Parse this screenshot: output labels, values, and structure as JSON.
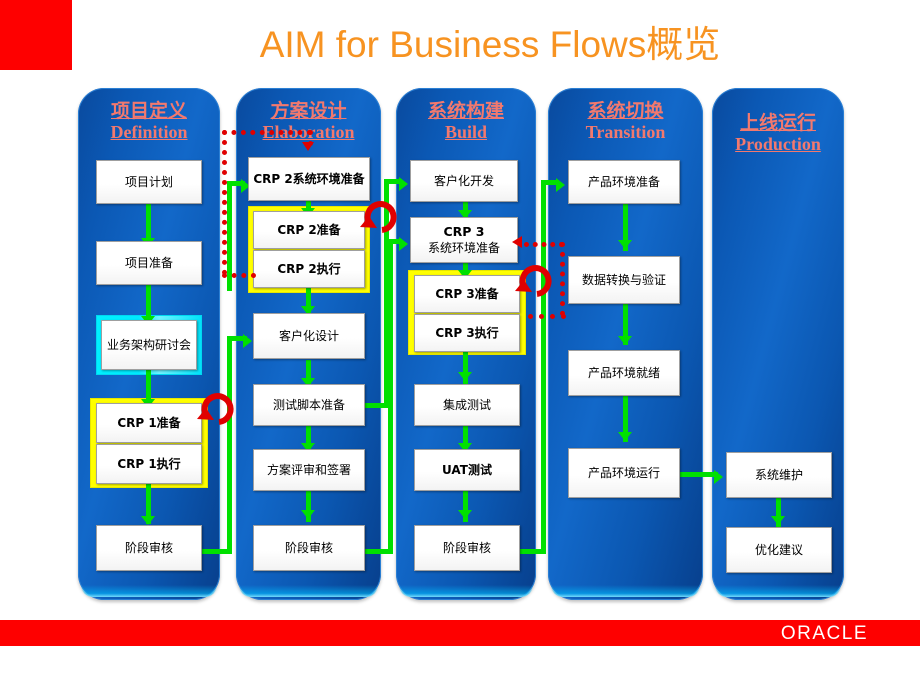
{
  "slide": {
    "title": "AIM for Business Flows概览",
    "title_color": "#f79321",
    "footer_brand": "ORACLE",
    "accent_red": "#fe0000",
    "column_bg_blue": "#0b58b4",
    "header_text_color": "#f2796e",
    "connector_green": "#00e000",
    "loop_red": "#e00000",
    "highlight_yellow": "#ffff00",
    "highlight_cyan": "#00e9ff"
  },
  "columns": [
    {
      "id": "definition",
      "title_cn": "项目定义",
      "title_en": "Definition",
      "boxes": [
        {
          "label": "项目计划",
          "bold": false
        },
        {
          "label": "项目准备",
          "bold": false
        },
        {
          "label": "业务架构研讨会",
          "bold": false,
          "highlight": "cyan"
        },
        {
          "label": "CRP 1准备",
          "bold": true,
          "highlight": "yellow"
        },
        {
          "label": "CRP 1执行",
          "bold": true,
          "highlight": "yellow"
        },
        {
          "label": "阶段审核",
          "bold": false
        }
      ]
    },
    {
      "id": "elaboration",
      "title_cn": "方案设计",
      "title_en": "Elaboration",
      "boxes": [
        {
          "label": "CRP 2系统环境准备",
          "bold": true
        },
        {
          "label": "CRP 2准备",
          "bold": true,
          "highlight": "yellow"
        },
        {
          "label": "CRP 2执行",
          "bold": true,
          "highlight": "yellow"
        },
        {
          "label": "客户化设计",
          "bold": false
        },
        {
          "label": "测试脚本准备",
          "bold": false
        },
        {
          "label": "方案评审和签署",
          "bold": false
        },
        {
          "label": "阶段审核",
          "bold": false
        }
      ]
    },
    {
      "id": "build",
      "title_cn": "系统构建",
      "title_en": "Build",
      "boxes": [
        {
          "label": "客户化开发",
          "bold": false
        },
        {
          "label_line1": "CRP 3",
          "label_line2": "系统环境准备",
          "bold": true
        },
        {
          "label": "CRP 3准备",
          "bold": true,
          "highlight": "yellow"
        },
        {
          "label": "CRP 3执行",
          "bold": true,
          "highlight": "yellow"
        },
        {
          "label": "集成测试",
          "bold": false
        },
        {
          "label": "UAT测试",
          "bold": true
        },
        {
          "label": "阶段审核",
          "bold": false
        }
      ]
    },
    {
      "id": "transition",
      "title_cn": "系统切换",
      "title_en": "Transition",
      "boxes": [
        {
          "label": "产品环境准备",
          "bold": false
        },
        {
          "label": "数据转换与验证",
          "bold": false
        },
        {
          "label": "产品环境就绪",
          "bold": false
        },
        {
          "label": "产品环境运行",
          "bold": false
        }
      ]
    },
    {
      "id": "production",
      "title_cn": "上线运行",
      "title_en": "Production",
      "boxes": [
        {
          "label": "系统维护",
          "bold": false
        },
        {
          "label": "优化建议",
          "bold": false
        }
      ]
    }
  ]
}
